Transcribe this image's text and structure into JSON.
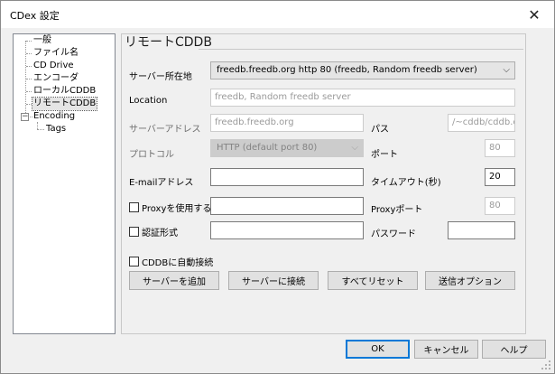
{
  "window": {
    "title": "CDex 設定"
  },
  "tree": {
    "items": [
      "一般",
      "ファイル名",
      "CD Drive",
      "エンコーダ",
      "ローカルCDDB",
      "リモートCDDB",
      "Encoding",
      "Tags"
    ],
    "expander": "−"
  },
  "panel": {
    "title": "リモートCDDB",
    "server_location": {
      "label": "サーバー所在地",
      "value": "freedb.freedb.org http  80  (freedb, Random freedb server)"
    },
    "location": {
      "label": "Location",
      "value": "freedb, Random freedb server"
    },
    "server_address": {
      "label": "サーバーアドレス",
      "value": "freedb.freedb.org"
    },
    "path": {
      "label": "パス",
      "value": "/~cddb/cddb.cgi"
    },
    "protocol": {
      "label": "プロトコル",
      "value": "HTTP (default port 80)"
    },
    "port": {
      "label": "ポート",
      "value": "80"
    },
    "email": {
      "label": "E-mailアドレス",
      "value": ""
    },
    "timeout": {
      "label": "タイムアウト(秒)",
      "value": "20"
    },
    "proxy": {
      "label": "Proxyを使用する",
      "value": ""
    },
    "proxy_port": {
      "label": "Proxyポート",
      "value": "80"
    },
    "auth": {
      "label": "認証形式",
      "value": ""
    },
    "password": {
      "label": "パスワード",
      "value": ""
    },
    "auto_connect": {
      "label": "CDDBに自動接続"
    },
    "buttons": {
      "add_server": "サーバーを追加",
      "connect_server": "サーバーに接続",
      "reset_all": "すべてリセット",
      "send_options": "送信オプション"
    }
  },
  "footer": {
    "ok": "OK",
    "cancel": "キャンセル",
    "help": "ヘルプ"
  },
  "colors": {
    "accent": "#0078d7",
    "window_bg": "#f0f0f0"
  }
}
